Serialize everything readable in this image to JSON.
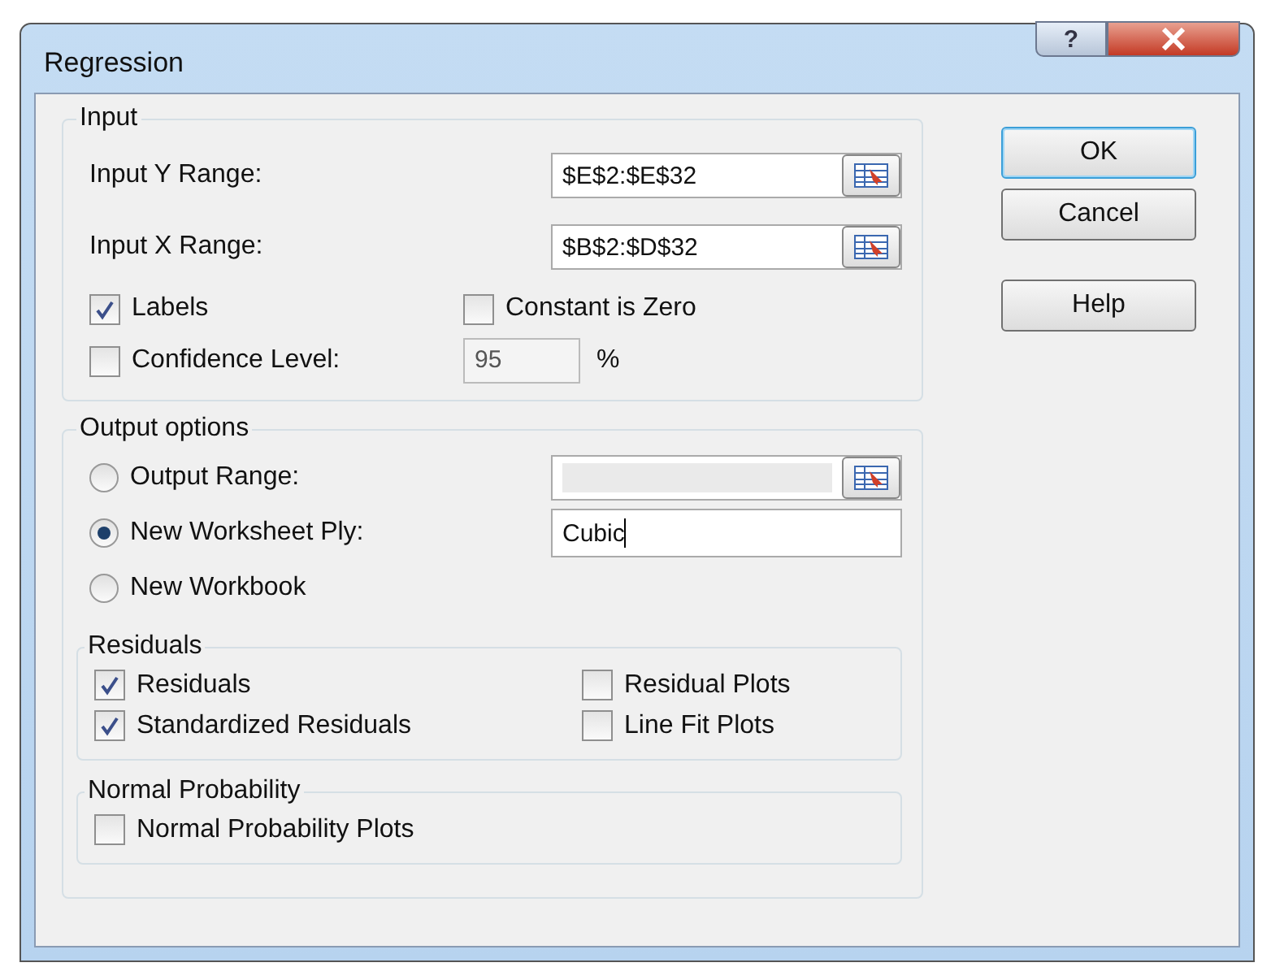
{
  "window": {
    "title": "Regression",
    "help_button": "?"
  },
  "input": {
    "title": "Input",
    "ranges": [
      {
        "label": "Input Y Range:",
        "value": "$E$2:$E$32"
      },
      {
        "label": "Input X Range:",
        "value": "$B$2:$D$32"
      }
    ],
    "options": [
      {
        "label": "Labels",
        "checked": true
      },
      {
        "label": "Constant is Zero",
        "checked": false
      }
    ],
    "confidence": {
      "label": "Confidence Level:",
      "checked": false,
      "value": "95",
      "unit": "%",
      "disabled": true
    }
  },
  "output": {
    "title": "Output options",
    "destinations": [
      {
        "label": "Output Range:",
        "selected": false,
        "kind": "range",
        "disabled": true
      },
      {
        "label": "New Worksheet Ply:",
        "selected": true,
        "kind": "text",
        "value": "Cubic"
      },
      {
        "label": "New Workbook",
        "selected": false,
        "kind": "none"
      }
    ],
    "residuals": {
      "title": "Residuals",
      "options": [
        {
          "label": "Residuals",
          "checked": true
        },
        {
          "label": "Residual Plots",
          "checked": false
        },
        {
          "label": "Standardized Residuals",
          "checked": true
        },
        {
          "label": "Line Fit Plots",
          "checked": false
        }
      ]
    },
    "normal_probability": {
      "title": "Normal Probability",
      "options": [
        {
          "label": "Normal Probability Plots",
          "checked": false
        }
      ]
    }
  },
  "buttons": [
    {
      "label": "OK",
      "default": true
    },
    {
      "label": "Cancel",
      "default": false
    },
    {
      "label": "Help",
      "default": false
    }
  ]
}
